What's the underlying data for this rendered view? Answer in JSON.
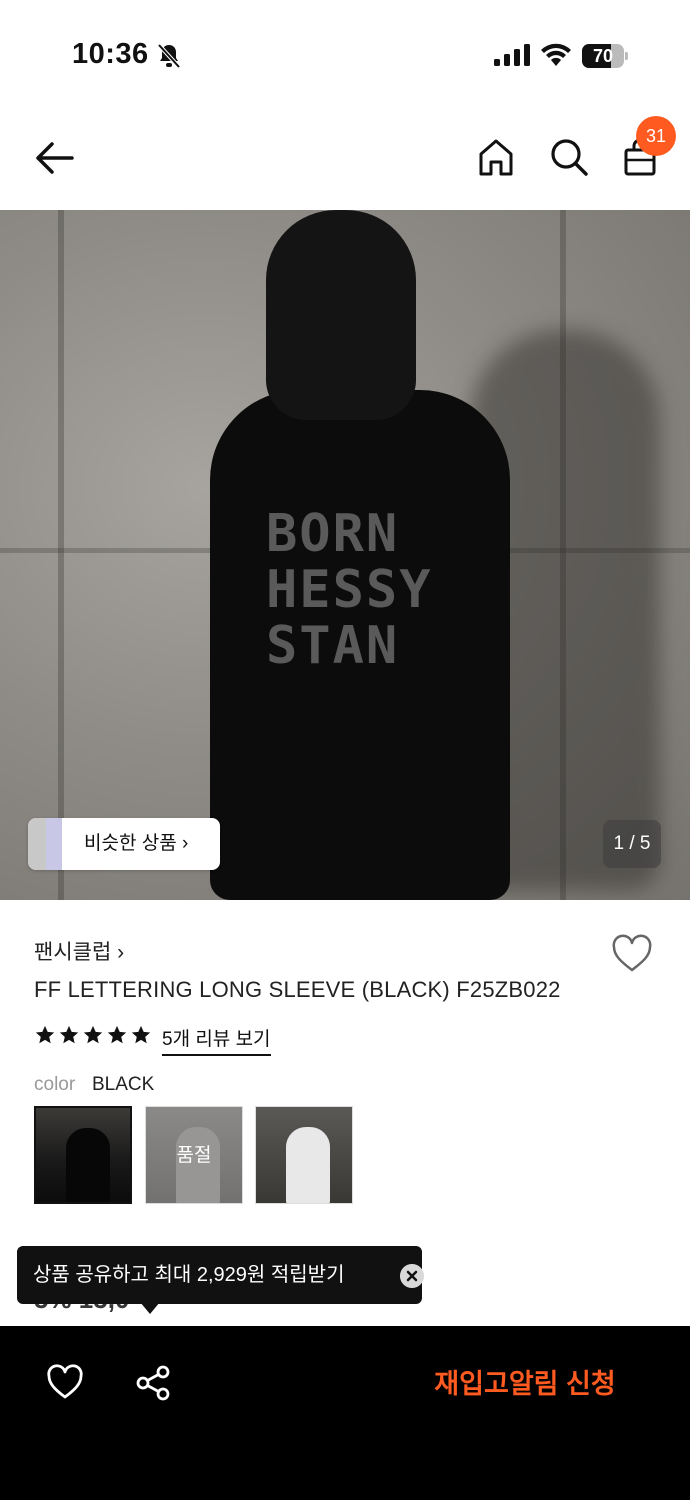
{
  "status_bar": {
    "time": "10:36",
    "battery_level": 70,
    "battery_label": "70",
    "icons": [
      "bell-off-icon",
      "cellular-signal-icon",
      "wifi-icon",
      "battery-icon"
    ]
  },
  "nav": {
    "icons": [
      "back-arrow-icon",
      "home-icon",
      "search-icon",
      "shopping-bag-icon"
    ],
    "cart_count": "31"
  },
  "gallery": {
    "similar_products_label": "비슷한 상품",
    "page_indicator": "1 / 5",
    "current_page": 1,
    "total_pages": 5
  },
  "product": {
    "brand": "팬시클럽",
    "title": "FF LETTERING LONG SLEEVE (BLACK) F25ZB022",
    "rating_stars": 5,
    "review_link": "5개 리뷰 보기",
    "color_label": "color",
    "color_value": "BLACK",
    "swatches": [
      {
        "selected": true
      },
      {
        "sold_out_label": "품절"
      },
      {}
    ],
    "price_partial": "5% 15,0"
  },
  "tooltip": {
    "text": "상품 공유하고 최대 2,929원 적립받기"
  },
  "bottom_bar": {
    "restock_label": "재입고알림 신청",
    "accent_color": "#ff5a1f"
  }
}
